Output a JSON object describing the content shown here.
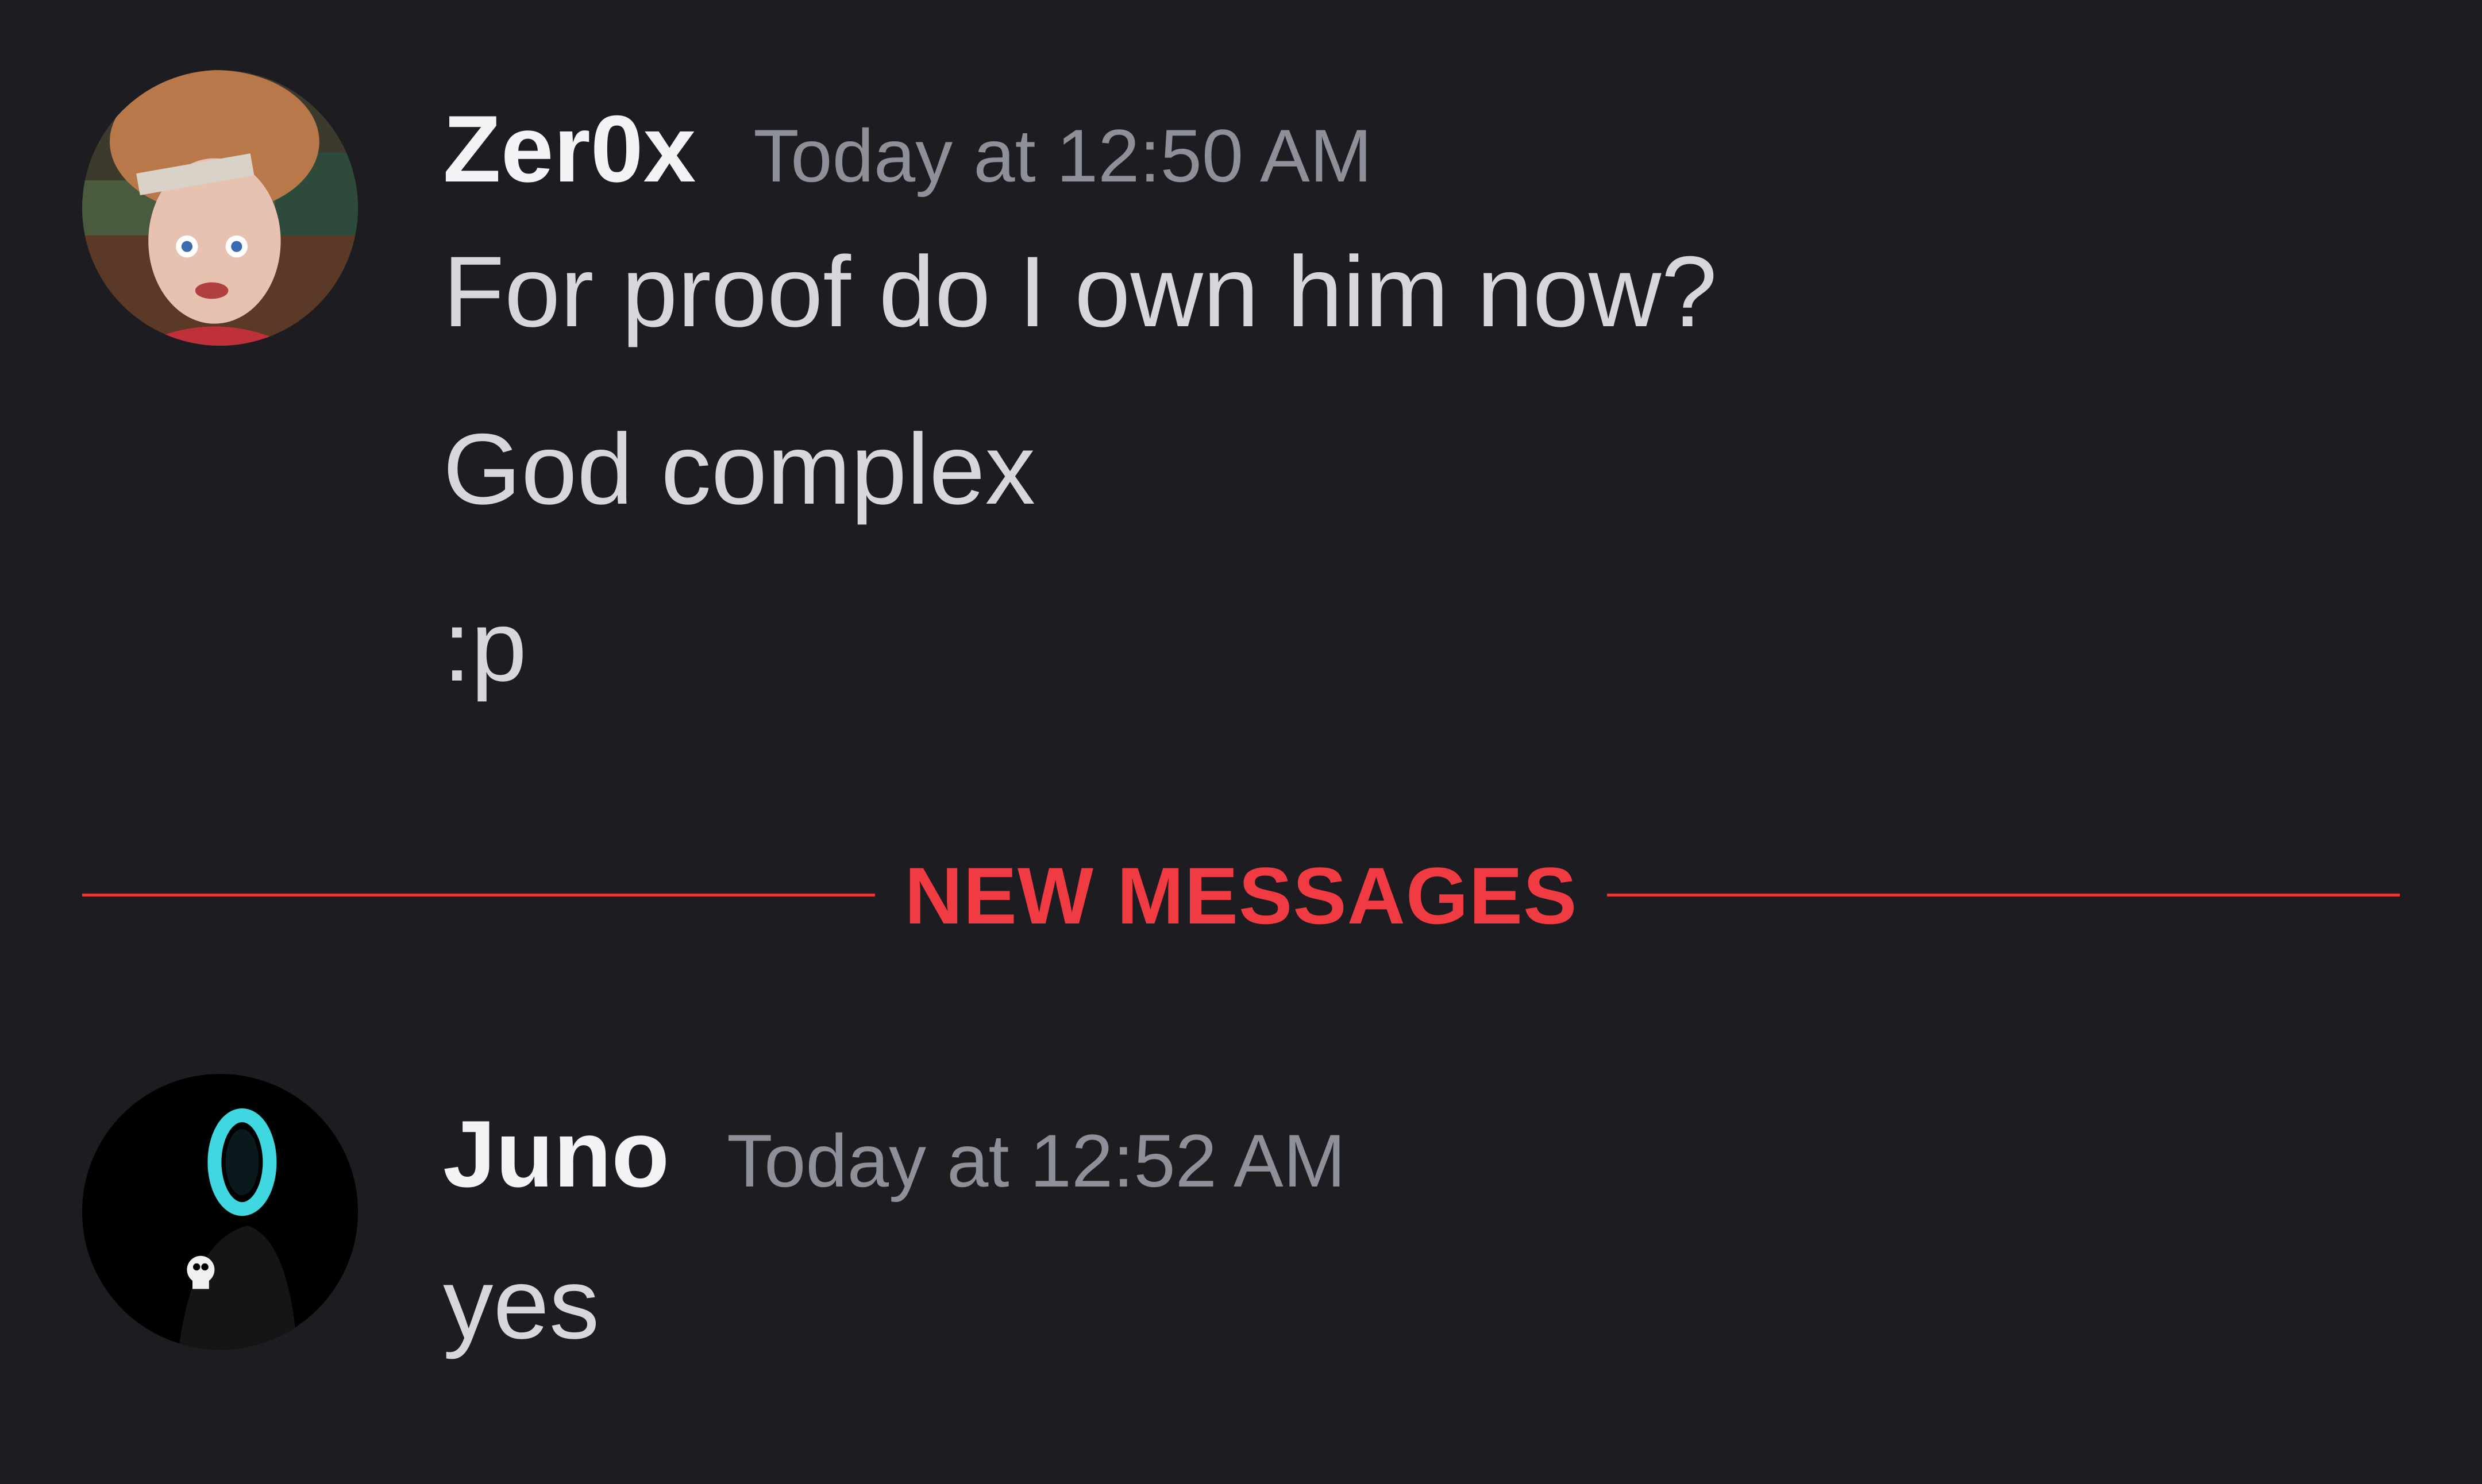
{
  "colors": {
    "background": "#1c1c21",
    "username": "#f2f3f5",
    "timestamp": "#8e9099",
    "message_text": "#d6d7dc",
    "new_messages_accent": "#e5383b"
  },
  "messages": [
    {
      "username": "Zer0x",
      "timestamp": "Today at 12:50 AM",
      "avatar_icon": "cartoon-boy-avatar",
      "lines": [
        "For proof do I own him now?",
        "God complex",
        ":p"
      ]
    },
    {
      "username": "Juno",
      "timestamp": "Today at 12:52 AM",
      "avatar_icon": "hooded-skull-avatar",
      "lines": [
        "yes"
      ]
    }
  ],
  "divider": {
    "label": "NEW MESSAGES"
  }
}
